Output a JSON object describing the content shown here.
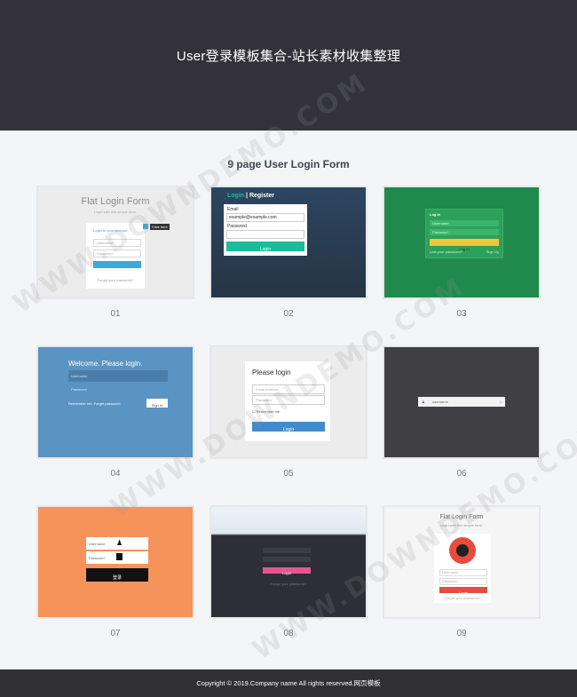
{
  "header": {
    "title": "User登录模板集合-站长素材收集整理"
  },
  "section": {
    "title": "9 page User Login Form"
  },
  "cards": [
    {
      "number": "01",
      "heading": "Flat Login Form",
      "subheading": "Login with this simple form.",
      "form_title": "Login to your account",
      "badge": "Click here",
      "username_placeholder": "Username",
      "password_placeholder": "Password",
      "button": "Login",
      "link": "Forgot your password?"
    },
    {
      "number": "02",
      "tab_login": "Login",
      "tab_separator": "|",
      "tab_register": "Register",
      "email_label": "Email",
      "email_value": "example@example.com",
      "password_label": "Password",
      "button": "Login"
    },
    {
      "number": "03",
      "title": "Log In",
      "username_placeholder": "Username",
      "password_placeholder": "Password",
      "button": "Log In",
      "link_left": "Lost your password?",
      "link_right": "Sign Up"
    },
    {
      "number": "04",
      "heading": "Welcome. Please login.",
      "username_placeholder": "Username",
      "password_placeholder": "Password",
      "remember": "Remember me. Forget password",
      "button": "Sign In"
    },
    {
      "number": "05",
      "heading": "Please login",
      "email_placeholder": "Email Address",
      "password_placeholder": "Password",
      "remember": "Remember me",
      "button": "Login"
    },
    {
      "number": "06",
      "username_placeholder": "username"
    },
    {
      "number": "07",
      "username_placeholder": "Username",
      "password_placeholder": "Password",
      "button": "登录"
    },
    {
      "number": "08",
      "button": "Login",
      "link": "Forgot your password?"
    },
    {
      "number": "09",
      "heading": "Flat Login Form",
      "subheading": "Login with this simple form.",
      "username_placeholder": "Username",
      "password_placeholder": "Password",
      "button": "Login",
      "link": "Forgot your password?"
    }
  ],
  "footer": {
    "text": "Copyright © 2019.Company name All rights reserved.网页模板"
  },
  "watermark": {
    "text": "WWW.DOWNDEMO.COM"
  },
  "colors": {
    "header_bg": "#33323b",
    "page_bg": "#f4f5f7",
    "footer_bg": "#303034",
    "teal": "#1abc9c",
    "green": "#1f8a4c",
    "blue": "#5a94c2",
    "orange": "#f6935a",
    "red": "#e74c3c"
  }
}
